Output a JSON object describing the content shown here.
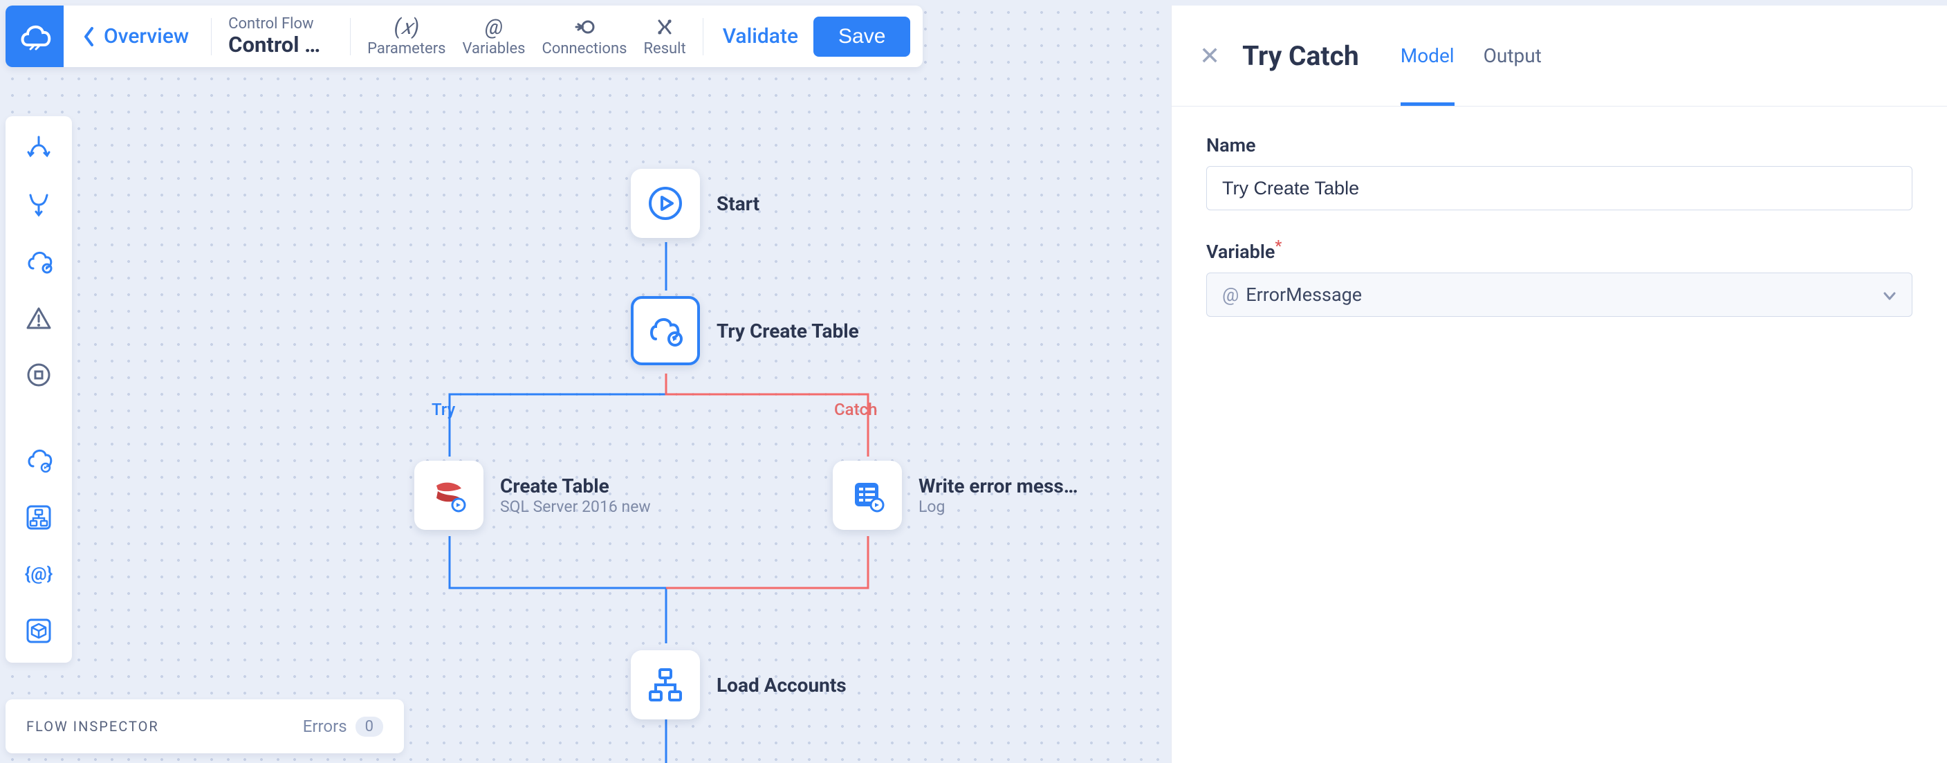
{
  "topbar": {
    "overview": "Overview",
    "breadcrumb_sup": "Control Flow",
    "breadcrumb_main": "Control Flo…",
    "buttons": {
      "parameters": "Parameters",
      "variables": "Variables",
      "connections": "Connections",
      "result": "Result"
    },
    "validate": "Validate",
    "save": "Save"
  },
  "canvas": {
    "nodes": {
      "start": {
        "title": "Start"
      },
      "tryCreate": {
        "title": "Try Create Table"
      },
      "createTable": {
        "title": "Create Table",
        "subtitle": "SQL Server 2016 new"
      },
      "writeError": {
        "title": "Write error mess…",
        "subtitle": "Log"
      },
      "loadAccounts": {
        "title": "Load Accounts"
      }
    },
    "branches": {
      "try": "Try",
      "catch": "Catch"
    }
  },
  "inspector": {
    "label": "FLOW INSPECTOR",
    "errors_label": "Errors",
    "errors_count": "0"
  },
  "panel": {
    "title": "Try Catch",
    "tabs": {
      "model": "Model",
      "output": "Output"
    },
    "fields": {
      "name_label": "Name",
      "name_value": "Try Create Table",
      "variable_label": "Variable",
      "variable_value": "ErrorMessage"
    }
  }
}
